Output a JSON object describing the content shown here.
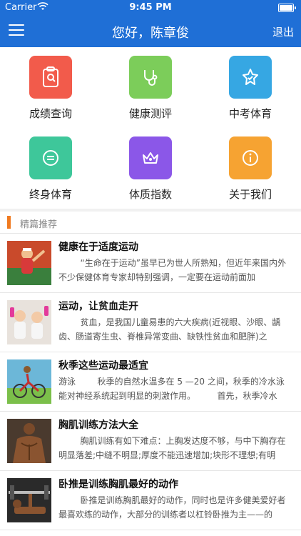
{
  "status_bar": {
    "carrier": "Carrier",
    "time": "9:45 PM"
  },
  "nav_bar": {
    "title": "您好，陈章俊",
    "logout": "退出"
  },
  "menu": {
    "items": [
      {
        "label": "成绩查询",
        "icon": "score-report-icon",
        "color": "#f25b4b"
      },
      {
        "label": "健康测评",
        "icon": "health-assessment-icon",
        "color": "#7ccd5a"
      },
      {
        "label": "中考体育",
        "icon": "exam-sports-icon",
        "color": "#36a7e3"
      },
      {
        "label": "终身体育",
        "icon": "lifelong-sports-icon",
        "color": "#3ec79a"
      },
      {
        "label": "体质指数",
        "icon": "crown-icon",
        "color": "#8b57e8"
      },
      {
        "label": "关于我们",
        "icon": "info-icon",
        "color": "#f6a332"
      }
    ]
  },
  "section": {
    "title": "精篇推荐"
  },
  "articles": [
    {
      "title": "健康在于适度运动",
      "summary": "        “生命在于运动”虽早已为世人所熟知，但近年来国内外不少保健体育专家却特别强调，一定要在运动前面加"
    },
    {
      "title": "运动，让贫血走开",
      "summary": "        贫血，是我国儿童易患的六大疾病(近视眼、沙眼、龋齿、肠道寄生虫、脊椎异常变曲、缺铁性贫血和肥胖)之"
    },
    {
      "title": "秋季这些运动最适宜",
      "summary": "游泳        秋季的自然水温多在 5 —20 之间，秋季的冷水泳能对神经系统起到明显的刺激作用。        首先，秋季冷水"
    },
    {
      "title": "胸肌训练方法大全",
      "summary": "        胸肌训练有如下难点：上胸发达度不够，与中下胸存在明显落差;中缝不明显;厚度不能迅速增加;块形不理想;有明"
    },
    {
      "title": "卧推是训练胸肌最好的动作",
      "summary": "        卧推是训练胸肌最好的动作，同时也是许多健美爱好者最喜欢练的动作，大部分的训练者以杠铃卧推为主——的"
    }
  ]
}
